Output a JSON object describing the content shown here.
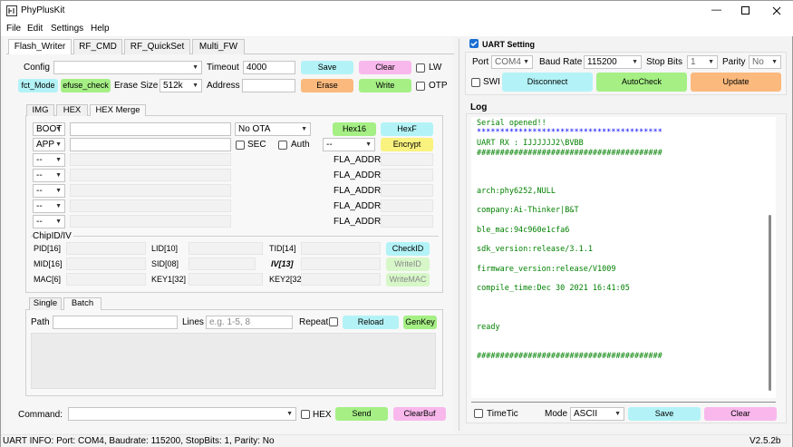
{
  "app": {
    "title": "PhyPlusKit",
    "version": "V2.5.2b"
  },
  "menu": [
    "File",
    "Edit",
    "Settings",
    "Help"
  ],
  "tabs": [
    "Flash_Writer",
    "RF_CMD",
    "RF_QuickSet",
    "Multi_FW"
  ],
  "config": {
    "label": "Config",
    "value": "",
    "timeout_label": "Timeout",
    "timeout_value": "4000",
    "save": "Save",
    "clear": "Clear",
    "lw": "LW"
  },
  "row2": {
    "fct_mode": "fct_Mode",
    "efuse_check": "efuse_check",
    "erase_size_label": "Erase Size",
    "erase_size_value": "512k",
    "address_label": "Address",
    "erase": "Erase",
    "write": "Write",
    "otp": "OTP"
  },
  "subtabs": [
    "IMG",
    "HEX",
    "HEX Merge"
  ],
  "hex": {
    "boot": "BOOT",
    "app": "APP",
    "dash": "--",
    "no_ota": "No OTA",
    "sec": "SEC",
    "auth": "Auth",
    "hex16": "Hex16",
    "hexf": "HexF",
    "encrypt": "Encrypt",
    "fla_addr": "FLA_ADDR"
  },
  "chip": {
    "title": "ChipID/IV",
    "pid": "PID[16]",
    "lid": "LID[10]",
    "tid": "TID[14]",
    "checkid": "CheckID",
    "mid": "MID[16]",
    "sid": "SID[08]",
    "iv": "IV[13]",
    "writeid": "WriteID",
    "mac": "MAC[6]",
    "key1": "KEY1[32]",
    "key2": "KEY2[32]",
    "writemac": "WriteMAC"
  },
  "batch": {
    "tabs": [
      "Single",
      "Batch"
    ],
    "path_label": "Path",
    "lines_label": "Lines",
    "lines_placeholder": "e.g. 1-5, 8",
    "repeat": "Repeat",
    "reload": "Reload",
    "genkey": "GenKey"
  },
  "command": {
    "label": "Command:",
    "hex": "HEX",
    "send": "Send",
    "clearbuf": "ClearBuf"
  },
  "uart": {
    "title": "UART Setting",
    "port_label": "Port",
    "port_value": "COM4",
    "baud_label": "Baud Rate",
    "baud_value": "115200",
    "stop_label": "Stop Bits",
    "stop_value": "1",
    "parity_label": "Parity",
    "parity_value": "No",
    "swi": "SWI",
    "disconnect": "Disconnect",
    "autocheck": "AutoCheck",
    "update": "Update"
  },
  "log": {
    "title": "Log",
    "lines": [
      "Serial opened!!",
      "****************************************",
      "UART RX : IJJJJJJ2\\BVBB",
      "########################################",
      "arch:phy6252,NULL",
      "company:Ai-Thinker|B&T",
      "ble_mac:94c960e1cfa6",
      "sdk_version:release/3.1.1",
      "firmware_version:release/V1009",
      "compile_time:Dec 30 2021 16:41:05",
      "ready",
      "########################################"
    ],
    "timetic": "TimeTic",
    "mode_label": "Mode",
    "mode_value": "ASCII",
    "save": "Save",
    "clear": "Clear"
  },
  "status": "UART INFO: Port: COM4, Baudrate: 115200, StopBits: 1, Parity: No",
  "colors": {
    "cyan": "#b3f3f7",
    "pink": "#f9b8ec",
    "green": "#a5ef85",
    "yellow": "#f9f27f",
    "orange": "#fbb97d",
    "log_green": "#008000",
    "log_blue": "#0000ff"
  }
}
